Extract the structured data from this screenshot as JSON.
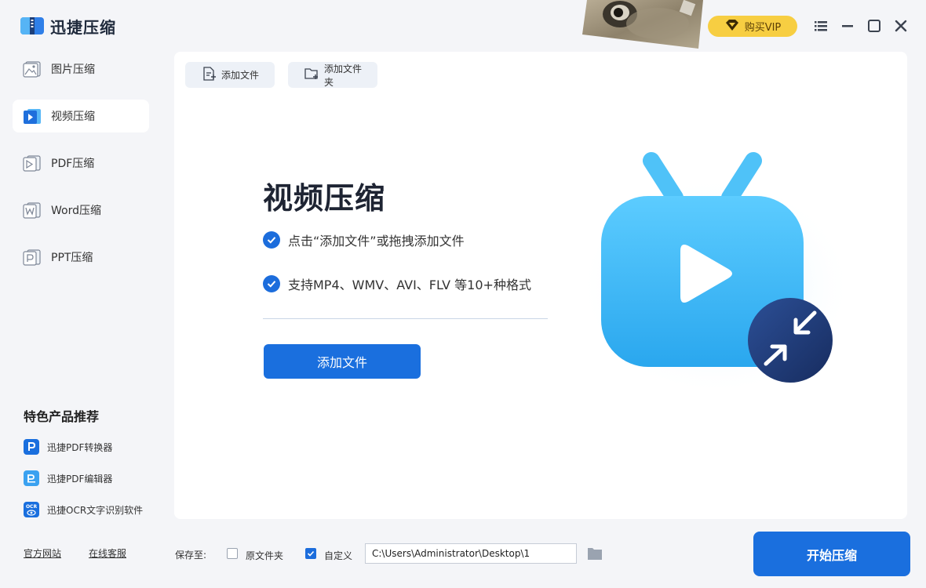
{
  "app": {
    "title": "迅捷压缩",
    "vip_label": "购买VIP"
  },
  "colors": {
    "accent": "#1a6fde",
    "vip": "#f7ce42",
    "tv_body": "#3cb8f3",
    "compress_badge": "#1f3a78"
  },
  "window_controls": [
    "menu-icon",
    "minimize-icon",
    "maximize-icon",
    "close-icon"
  ],
  "sidebar": {
    "items": [
      {
        "label": "图片压缩",
        "icon": "image-icon"
      },
      {
        "label": "视频压缩",
        "icon": "video-icon",
        "active": true
      },
      {
        "label": "PDF压缩",
        "icon": "pdf-icon"
      },
      {
        "label": "Word压缩",
        "icon": "word-icon"
      },
      {
        "label": "PPT压缩",
        "icon": "ppt-icon"
      }
    ],
    "recommend_title": "特色产品推荐",
    "recommend": [
      {
        "label": "迅捷PDF转换器",
        "icon": "pdf-converter-icon"
      },
      {
        "label": "迅捷PDF编辑器",
        "icon": "pdf-editor-icon"
      },
      {
        "label": "迅捷OCR文字识别软件",
        "icon": "ocr-icon",
        "icon_text": "OCR"
      }
    ],
    "links": [
      "官方网站",
      "在线客服"
    ]
  },
  "toolbar": {
    "add_file": "添加文件",
    "add_folder": "添加文件夹"
  },
  "main": {
    "heading": "视频压缩",
    "features": [
      "点击“添加文件”或拖拽添加文件",
      "支持MP4、WMV、AVI、FLV 等10+种格式"
    ],
    "add_button": "添加文件"
  },
  "bottom": {
    "save_to_label": "保存至:",
    "option_original": "原文件夹",
    "option_custom": "自定义",
    "original_checked": false,
    "custom_checked": true,
    "path": "C:\\Users\\Administrator\\Desktop\\1",
    "start_button": "开始压缩"
  }
}
